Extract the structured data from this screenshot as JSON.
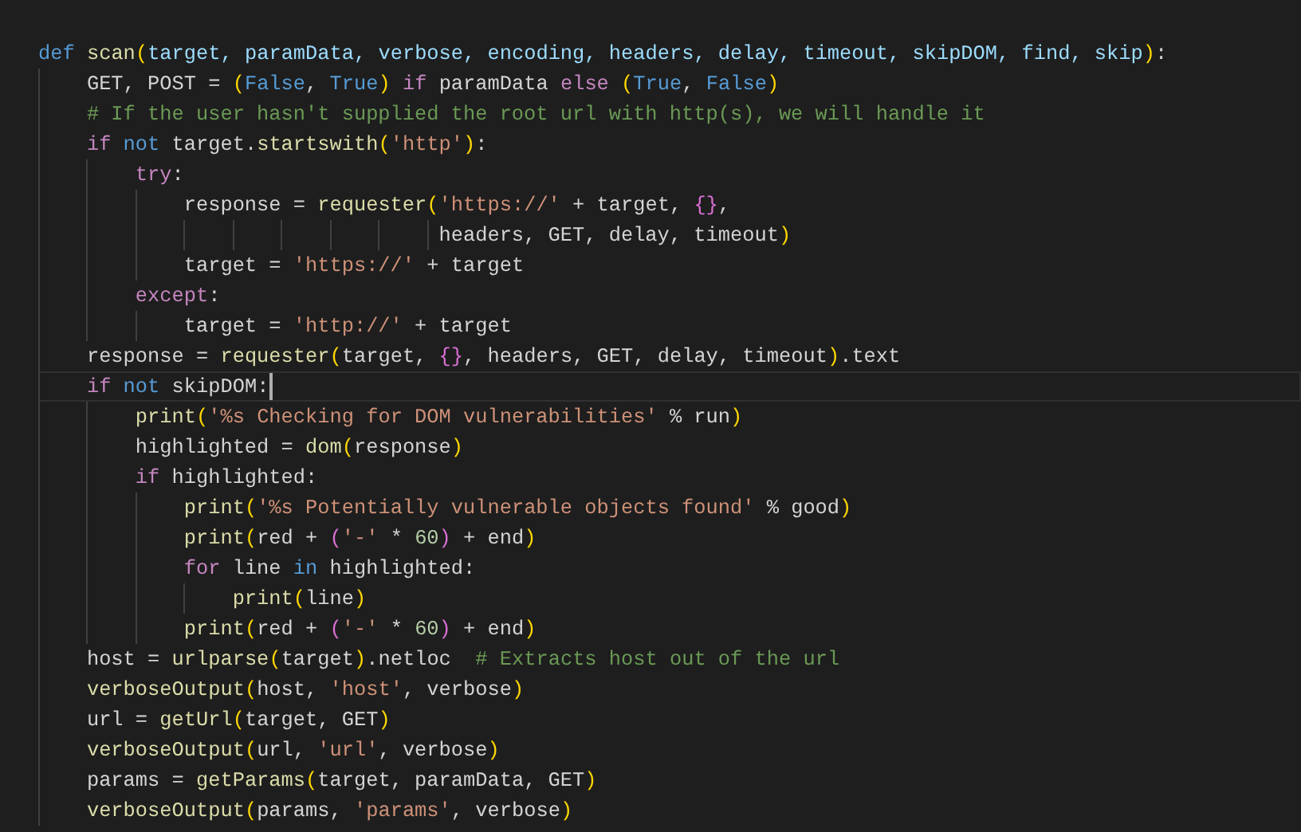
{
  "editor": {
    "lines": [
      {
        "current": false,
        "tokens": [
          {
            "kind": "keyword",
            "text": "def "
          },
          {
            "kind": "function",
            "text": "scan"
          },
          {
            "kind": "bracket1",
            "text": "("
          },
          {
            "kind": "param",
            "text": "target, paramData, verbose, encoding, headers, delay, timeout, skipDOM, find, skip"
          },
          {
            "kind": "bracket1",
            "text": ")"
          },
          {
            "kind": "plain",
            "text": ":"
          }
        ]
      },
      {
        "current": false,
        "tokens": [
          {
            "kind": "plain",
            "text": "    GET, POST = "
          },
          {
            "kind": "bracket1",
            "text": "("
          },
          {
            "kind": "keyword",
            "text": "False"
          },
          {
            "kind": "plain",
            "text": ", "
          },
          {
            "kind": "keyword",
            "text": "True"
          },
          {
            "kind": "bracket1",
            "text": ")"
          },
          {
            "kind": "control",
            "text": " if"
          },
          {
            "kind": "plain",
            "text": " paramData "
          },
          {
            "kind": "control",
            "text": "else "
          },
          {
            "kind": "bracket1",
            "text": "("
          },
          {
            "kind": "keyword",
            "text": "True"
          },
          {
            "kind": "plain",
            "text": ", "
          },
          {
            "kind": "keyword",
            "text": "False"
          },
          {
            "kind": "bracket1",
            "text": ")"
          }
        ]
      },
      {
        "current": false,
        "tokens": [
          {
            "kind": "comment",
            "text": "    # If the user hasn't supplied the root url with http(s), we will handle it"
          }
        ]
      },
      {
        "current": false,
        "tokens": [
          {
            "kind": "control",
            "text": "    if"
          },
          {
            "kind": "keyword",
            "text": " not"
          },
          {
            "kind": "plain",
            "text": " target."
          },
          {
            "kind": "function",
            "text": "startswith"
          },
          {
            "kind": "bracket1",
            "text": "("
          },
          {
            "kind": "string",
            "text": "'http'"
          },
          {
            "kind": "bracket1",
            "text": ")"
          },
          {
            "kind": "plain",
            "text": ":"
          }
        ]
      },
      {
        "current": false,
        "tokens": [
          {
            "kind": "control",
            "text": "        try"
          },
          {
            "kind": "plain",
            "text": ":"
          }
        ]
      },
      {
        "current": false,
        "tokens": [
          {
            "kind": "plain",
            "text": "            response = "
          },
          {
            "kind": "function",
            "text": "requester"
          },
          {
            "kind": "bracket1",
            "text": "("
          },
          {
            "kind": "string",
            "text": "'https://'"
          },
          {
            "kind": "plain",
            "text": " + target, "
          },
          {
            "kind": "bracket2",
            "text": "{}"
          },
          {
            "kind": "plain",
            "text": ","
          }
        ]
      },
      {
        "current": false,
        "tokens": [
          {
            "kind": "plain",
            "text": "                                 headers, GET, delay, timeout"
          },
          {
            "kind": "bracket1",
            "text": ")"
          }
        ]
      },
      {
        "current": false,
        "tokens": [
          {
            "kind": "plain",
            "text": "            target = "
          },
          {
            "kind": "string",
            "text": "'https://'"
          },
          {
            "kind": "plain",
            "text": " + target"
          }
        ]
      },
      {
        "current": false,
        "tokens": [
          {
            "kind": "control",
            "text": "        except"
          },
          {
            "kind": "plain",
            "text": ":"
          }
        ]
      },
      {
        "current": false,
        "tokens": [
          {
            "kind": "plain",
            "text": "            target = "
          },
          {
            "kind": "string",
            "text": "'http://'"
          },
          {
            "kind": "plain",
            "text": " + target"
          }
        ]
      },
      {
        "current": false,
        "tokens": [
          {
            "kind": "plain",
            "text": "    response = "
          },
          {
            "kind": "function",
            "text": "requester"
          },
          {
            "kind": "bracket1",
            "text": "("
          },
          {
            "kind": "plain",
            "text": "target, "
          },
          {
            "kind": "bracket2",
            "text": "{}"
          },
          {
            "kind": "plain",
            "text": ", headers, GET, delay, timeout"
          },
          {
            "kind": "bracket1",
            "text": ")"
          },
          {
            "kind": "plain",
            "text": ".text"
          }
        ]
      },
      {
        "current": true,
        "tokens": [
          {
            "kind": "control",
            "text": "    if"
          },
          {
            "kind": "keyword",
            "text": " not"
          },
          {
            "kind": "plain",
            "text": " skipDOM:"
          }
        ]
      },
      {
        "current": false,
        "tokens": [
          {
            "kind": "function",
            "text": "        print"
          },
          {
            "kind": "bracket1",
            "text": "("
          },
          {
            "kind": "string",
            "text": "'%s Checking for DOM vulnerabilities'"
          },
          {
            "kind": "plain",
            "text": " % run"
          },
          {
            "kind": "bracket1",
            "text": ")"
          }
        ]
      },
      {
        "current": false,
        "tokens": [
          {
            "kind": "plain",
            "text": "        highlighted = "
          },
          {
            "kind": "function",
            "text": "dom"
          },
          {
            "kind": "bracket1",
            "text": "("
          },
          {
            "kind": "plain",
            "text": "response"
          },
          {
            "kind": "bracket1",
            "text": ")"
          }
        ]
      },
      {
        "current": false,
        "tokens": [
          {
            "kind": "control",
            "text": "        if"
          },
          {
            "kind": "plain",
            "text": " highlighted:"
          }
        ]
      },
      {
        "current": false,
        "tokens": [
          {
            "kind": "function",
            "text": "            print"
          },
          {
            "kind": "bracket1",
            "text": "("
          },
          {
            "kind": "string",
            "text": "'%s Potentially vulnerable objects found'"
          },
          {
            "kind": "plain",
            "text": " % good"
          },
          {
            "kind": "bracket1",
            "text": ")"
          }
        ]
      },
      {
        "current": false,
        "tokens": [
          {
            "kind": "function",
            "text": "            print"
          },
          {
            "kind": "bracket1",
            "text": "("
          },
          {
            "kind": "plain",
            "text": "red + "
          },
          {
            "kind": "bracket2",
            "text": "("
          },
          {
            "kind": "string",
            "text": "'-'"
          },
          {
            "kind": "plain",
            "text": " * "
          },
          {
            "kind": "number",
            "text": "60"
          },
          {
            "kind": "bracket2",
            "text": ")"
          },
          {
            "kind": "plain",
            "text": " + end"
          },
          {
            "kind": "bracket1",
            "text": ")"
          }
        ]
      },
      {
        "current": false,
        "tokens": [
          {
            "kind": "control",
            "text": "            for"
          },
          {
            "kind": "plain",
            "text": " line "
          },
          {
            "kind": "keyword",
            "text": "in"
          },
          {
            "kind": "plain",
            "text": " highlighted:"
          }
        ]
      },
      {
        "current": false,
        "tokens": [
          {
            "kind": "function",
            "text": "                print"
          },
          {
            "kind": "bracket1",
            "text": "("
          },
          {
            "kind": "plain",
            "text": "line"
          },
          {
            "kind": "bracket1",
            "text": ")"
          }
        ]
      },
      {
        "current": false,
        "tokens": [
          {
            "kind": "function",
            "text": "            print"
          },
          {
            "kind": "bracket1",
            "text": "("
          },
          {
            "kind": "plain",
            "text": "red + "
          },
          {
            "kind": "bracket2",
            "text": "("
          },
          {
            "kind": "string",
            "text": "'-'"
          },
          {
            "kind": "plain",
            "text": " * "
          },
          {
            "kind": "number",
            "text": "60"
          },
          {
            "kind": "bracket2",
            "text": ")"
          },
          {
            "kind": "plain",
            "text": " + end"
          },
          {
            "kind": "bracket1",
            "text": ")"
          }
        ]
      },
      {
        "current": false,
        "tokens": [
          {
            "kind": "plain",
            "text": "    host = "
          },
          {
            "kind": "function",
            "text": "urlparse"
          },
          {
            "kind": "bracket1",
            "text": "("
          },
          {
            "kind": "plain",
            "text": "target"
          },
          {
            "kind": "bracket1",
            "text": ")"
          },
          {
            "kind": "plain",
            "text": ".netloc  "
          },
          {
            "kind": "comment",
            "text": "# Extracts host out of the url"
          }
        ]
      },
      {
        "current": false,
        "tokens": [
          {
            "kind": "function",
            "text": "    verboseOutput"
          },
          {
            "kind": "bracket1",
            "text": "("
          },
          {
            "kind": "plain",
            "text": "host, "
          },
          {
            "kind": "string",
            "text": "'host'"
          },
          {
            "kind": "plain",
            "text": ", verbose"
          },
          {
            "kind": "bracket1",
            "text": ")"
          }
        ]
      },
      {
        "current": false,
        "tokens": [
          {
            "kind": "plain",
            "text": "    url = "
          },
          {
            "kind": "function",
            "text": "getUrl"
          },
          {
            "kind": "bracket1",
            "text": "("
          },
          {
            "kind": "plain",
            "text": "target, GET"
          },
          {
            "kind": "bracket1",
            "text": ")"
          }
        ]
      },
      {
        "current": false,
        "tokens": [
          {
            "kind": "function",
            "text": "    verboseOutput"
          },
          {
            "kind": "bracket1",
            "text": "("
          },
          {
            "kind": "plain",
            "text": "url, "
          },
          {
            "kind": "string",
            "text": "'url'"
          },
          {
            "kind": "plain",
            "text": ", verbose"
          },
          {
            "kind": "bracket1",
            "text": ")"
          }
        ]
      },
      {
        "current": false,
        "tokens": [
          {
            "kind": "plain",
            "text": "    params = "
          },
          {
            "kind": "function",
            "text": "getParams"
          },
          {
            "kind": "bracket1",
            "text": "("
          },
          {
            "kind": "plain",
            "text": "target, paramData, GET"
          },
          {
            "kind": "bracket1",
            "text": ")"
          }
        ]
      },
      {
        "current": false,
        "tokens": [
          {
            "kind": "function",
            "text": "    verboseOutput"
          },
          {
            "kind": "bracket1",
            "text": "("
          },
          {
            "kind": "plain",
            "text": "params, "
          },
          {
            "kind": "string",
            "text": "'params'"
          },
          {
            "kind": "plain",
            "text": ", verbose"
          },
          {
            "kind": "bracket1",
            "text": ")"
          }
        ]
      }
    ]
  }
}
